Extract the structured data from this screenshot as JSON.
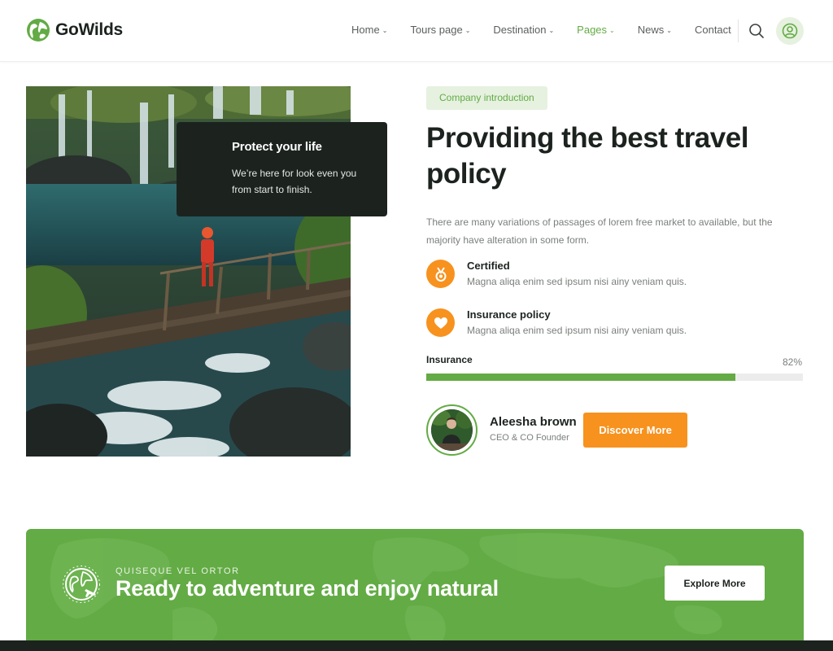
{
  "brand": {
    "name": "GoWilds",
    "accent": "#63ab45",
    "orange": "#f7921e",
    "dark": "#1c231f"
  },
  "nav": {
    "items": [
      {
        "label": "Home",
        "dropdown": true,
        "active": false
      },
      {
        "label": "Tours page",
        "dropdown": true,
        "active": false
      },
      {
        "label": "Destination",
        "dropdown": true,
        "active": false
      },
      {
        "label": "Pages",
        "dropdown": true,
        "active": true
      },
      {
        "label": "News",
        "dropdown": true,
        "active": false
      },
      {
        "label": "Contact",
        "dropdown": false,
        "active": false
      }
    ],
    "caret": "⌄",
    "icons": [
      "search-icon",
      "user-icon"
    ]
  },
  "card": {
    "title": "Protect your life",
    "text": "We’re here for look even you from start to finish."
  },
  "about": {
    "tag": "Company introduction",
    "title": "Providing the best travel policy",
    "description": "There are many variations of passages of lorem free market to available, but the majority have alteration in some form.",
    "features": [
      {
        "icon": "medal-icon",
        "title": "Certified",
        "text": "Magna aliqa enim sed ipsum nisi ainy veniam quis."
      },
      {
        "icon": "heart-icon",
        "title": "Insurance policy",
        "text": "Magna aliqa enim sed ipsum nisi ainy veniam quis."
      }
    ],
    "progress": {
      "label": "Insurance",
      "value_text": "82%",
      "value": 82
    },
    "person": {
      "name": "Aleesha brown",
      "role": "CEO & CO Founder"
    },
    "cta_label": "Discover More"
  },
  "banner": {
    "subtitle": "QUISEQUE VEL ORTOR",
    "title": "Ready to adventure and enjoy natural",
    "button": "Explore More",
    "icon": "globe-plane-icon"
  }
}
